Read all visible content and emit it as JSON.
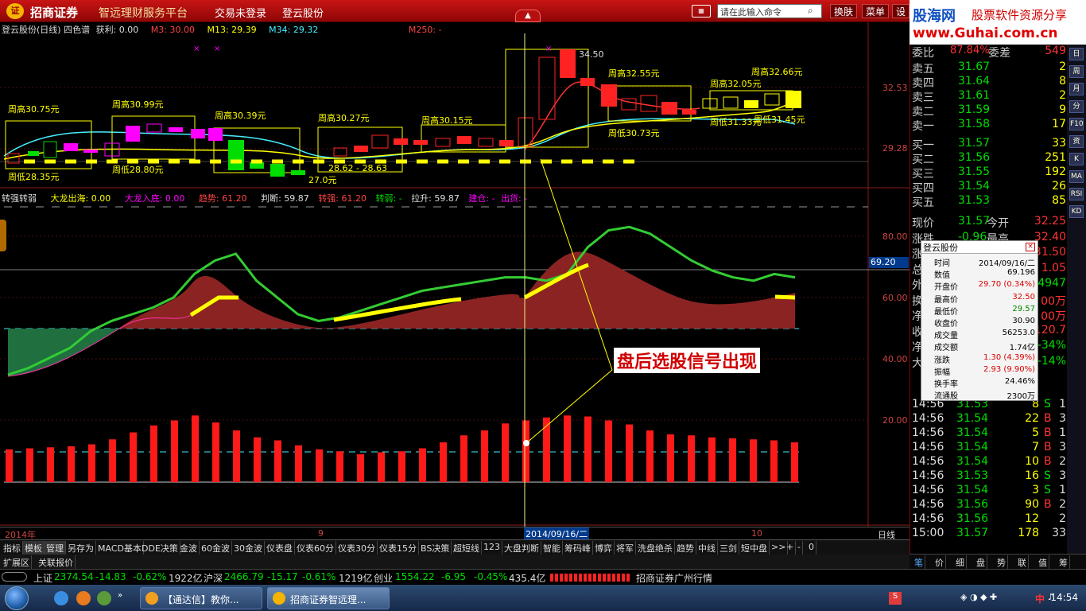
{
  "titlebar": {
    "logo": "证",
    "brand": "招商证券",
    "subtitle": "智远理财服务平台",
    "links": [
      "交易未登录",
      "登云股份"
    ],
    "search_placeholder": "请在此输入命令",
    "buttons": [
      "换肤",
      "菜单",
      "设"
    ]
  },
  "banner": {
    "line1": "股海网",
    "line2": "股票软件资源分享",
    "line3": "www.Guhai.com.cn"
  },
  "chart": {
    "top_info": [
      "登云股份(日线) 四色谱",
      "获利: 0.00",
      "M3: 30.00",
      "M13: 29.39",
      "M34: 29.32",
      "M250: -"
    ],
    "mid_info": [
      "转强转弱",
      "大龙出海: 0.00",
      "大龙入底: 0.00",
      "趋势: 61.20",
      "判断: 59.87",
      "转强: 61.20",
      "转弱: -",
      "拉升: 59.87",
      "建仓: -",
      "出货: -"
    ],
    "price_axis": [
      "32.53",
      "29.28"
    ],
    "osc_axis": [
      "80.00",
      "60.00",
      "40.00",
      "20.00"
    ],
    "cursor_value": "69.20",
    "week_labels": [
      "周高30.75元",
      "周低28.35元",
      "周高30.99元",
      "周低28.80元",
      "周高30.39元",
      "27.0元",
      "周高30.27元",
      "28.62 - 28.63",
      "周高30.15元",
      "周高32.55元",
      "周低30.73元",
      "周高32.05元",
      "周低31.33元",
      "周高32.66元",
      "周低31.45元"
    ],
    "candle_label": "34.50",
    "annotation": "盘后选股信号出现",
    "date_axis": [
      "2014年",
      "9",
      "2014/09/16/二",
      "10"
    ],
    "period": "日线"
  },
  "chart_data": {
    "type": "line",
    "x": [
      "2014-08-15",
      "2014-08-18",
      "2014-08-19",
      "2014-08-20",
      "2014-08-21",
      "2014-08-22",
      "2014-08-25",
      "2014-08-26",
      "2014-08-27",
      "2014-08-28",
      "2014-08-29",
      "2014-09-01",
      "2014-09-02",
      "2014-09-03",
      "2014-09-04",
      "2014-09-05",
      "2014-09-09",
      "2014-09-10",
      "2014-09-11",
      "2014-09-12",
      "2014-09-15",
      "2014-09-16",
      "2014-09-17",
      "2014-09-18",
      "2014-09-19",
      "2014-09-22",
      "2014-09-23",
      "2014-09-24",
      "2014-09-25",
      "2014-09-26",
      "2014-09-29",
      "2014-09-30",
      "2014-10-08",
      "2014-10-09",
      "2014-10-10",
      "2014-10-13",
      "2014-10-14",
      "2014-10-15",
      "2014-10-16"
    ],
    "series": [
      {
        "name": "趋势",
        "values": [
          32,
          34,
          37,
          40,
          45,
          48,
          50,
          52,
          55,
          62,
          66,
          68,
          60,
          55,
          50,
          48,
          49,
          51,
          53,
          55,
          57,
          58,
          59,
          60,
          61,
          61,
          60,
          62,
          70,
          75,
          76,
          74,
          70,
          66,
          63,
          61,
          60,
          62,
          61
        ]
      }
    ],
    "ylim": [
      0,
      100
    ]
  },
  "quotes": {
    "ratio_label": "委比",
    "ratio": "87.84%",
    "diff_label": "委差",
    "diff": "549",
    "sells": [
      {
        "label": "卖五",
        "price": "31.67",
        "vol": "2"
      },
      {
        "label": "卖四",
        "price": "31.64",
        "vol": "8"
      },
      {
        "label": "卖三",
        "price": "31.61",
        "vol": "2"
      },
      {
        "label": "卖二",
        "price": "31.59",
        "vol": "9"
      },
      {
        "label": "卖一",
        "price": "31.58",
        "vol": "17"
      }
    ],
    "buys": [
      {
        "label": "买一",
        "price": "31.57",
        "vol": "33"
      },
      {
        "label": "买二",
        "price": "31.56",
        "vol": "251"
      },
      {
        "label": "买三",
        "price": "31.55",
        "vol": "192"
      },
      {
        "label": "买四",
        "price": "31.54",
        "vol": "26"
      },
      {
        "label": "买五",
        "price": "31.53",
        "vol": "85"
      }
    ],
    "stats": [
      {
        "label": "现价",
        "value": "31.57",
        "label2": "今开",
        "value2": "32.25"
      },
      {
        "label": "涨跌",
        "value": "-0.96",
        "label2": "最高",
        "value2": "32.40"
      },
      {
        "label": "涨",
        "value": "",
        "label2": "",
        "value2": "31.50"
      },
      {
        "label": "总",
        "value": "",
        "label2": "",
        "value2": "1.05"
      },
      {
        "label": "外",
        "value": "",
        "label2": "",
        "value2": "4947"
      },
      {
        "label": "换",
        "value": "",
        "label2": "",
        "value2": "00万"
      },
      {
        "label": "净",
        "value": "",
        "label2": "",
        "value2": "00万"
      },
      {
        "label": "收",
        "value": "",
        "label2": "",
        "value2": "120.7"
      },
      {
        "label": "净",
        "value": "",
        "label2": "",
        "value2": "-34%"
      },
      {
        "label": "大",
        "value": "",
        "label2": "",
        "value2": "-14%"
      }
    ],
    "ticks": [
      {
        "time": "14:56",
        "price": "31.53",
        "vol": "8",
        "side": "S",
        "n": "1"
      },
      {
        "time": "14:56",
        "price": "31.54",
        "vol": "22",
        "side": "B",
        "n": "3"
      },
      {
        "time": "14:56",
        "price": "31.54",
        "vol": "5",
        "side": "B",
        "n": "1"
      },
      {
        "time": "14:56",
        "price": "31.54",
        "vol": "7",
        "side": "B",
        "n": "3"
      },
      {
        "time": "14:56",
        "price": "31.54",
        "vol": "10",
        "side": "B",
        "n": "2"
      },
      {
        "time": "14:56",
        "price": "31.53",
        "vol": "16",
        "side": "S",
        "n": "3"
      },
      {
        "time": "14:56",
        "price": "31.54",
        "vol": "3",
        "side": "S",
        "n": "1"
      },
      {
        "time": "14:56",
        "price": "31.56",
        "vol": "90",
        "side": "B",
        "n": "2"
      },
      {
        "time": "14:56",
        "price": "31.56",
        "vol": "12",
        "side": "",
        "n": "2"
      },
      {
        "time": "15:00",
        "price": "31.57",
        "vol": "178",
        "side": "",
        "n": "33"
      }
    ]
  },
  "popup": {
    "title": "登云股份",
    "rows": [
      {
        "label": "时间",
        "value": "2014/09/16/二"
      },
      {
        "label": "数值",
        "value": "69.196"
      },
      {
        "label": "开盘价",
        "value": "29.70 (0.34%)"
      },
      {
        "label": "最高价",
        "value": "32.50"
      },
      {
        "label": "最低价",
        "value": "29.57"
      },
      {
        "label": "收盘价",
        "value": "30.90"
      },
      {
        "label": "成交量",
        "value": "56253.0"
      },
      {
        "label": "成交额",
        "value": "1.74亿"
      },
      {
        "label": "涨跌",
        "value": "1.30 (4.39%)"
      },
      {
        "label": "振幅",
        "value": "2.93 (9.90%)"
      },
      {
        "label": "换手率",
        "value": "24.46%"
      },
      {
        "label": "流通股",
        "value": "2300万"
      }
    ]
  },
  "tabs": [
    "指标",
    "模板",
    "管理",
    "另存为",
    "MACD基本",
    "DDE决策",
    "金波",
    "60金波",
    "30金波",
    "仪表盘",
    "仪表60分",
    "仪表30分",
    "仪表15分",
    "BS决策",
    "超短线",
    "123",
    "大盘判断",
    "智能",
    "筹码峰",
    "博弈",
    "将军",
    "洗盘绝杀",
    "趋势",
    "中线",
    "三剑",
    "短中盘",
    ">>",
    "+",
    "-",
    "0"
  ],
  "tabs2": [
    "扩展区",
    "关联报价"
  ],
  "rtabs": [
    "笔",
    "价",
    "细",
    "盘",
    "势",
    "联",
    "值",
    "筹"
  ],
  "status": {
    "sh_label": "上证",
    "sh": "2374.54",
    "sh_chg": "-14.83",
    "sh_pct": "-0.62%",
    "sh_amt": "1922亿",
    "sz_label": "沪深",
    "sz": "2466.79",
    "sz_chg": "-15.17",
    "sz_pct": "-0.61%",
    "sz_amt": "1219亿",
    "cy_label": "创业",
    "cy": "1554.22",
    "cy_chg": "-6.95",
    "cy_pct": "-0.45%",
    "cy_amt": "435.4亿",
    "broker": "招商证券广州行情"
  },
  "taskbar": {
    "apps": [
      "【通达信】教你...",
      "招商证券智远理..."
    ],
    "clock": "14:54",
    "tray_lang": "中"
  },
  "side_icons": [
    "日",
    "周",
    "月",
    "分",
    "F10",
    "资",
    "K",
    "MA",
    "RSI",
    "KD"
  ],
  "colors": {
    "up": "#ff2020",
    "down": "#00d000",
    "accent": "#ffff00",
    "area": "#8b2323",
    "green_area": "#1f6f3f"
  }
}
